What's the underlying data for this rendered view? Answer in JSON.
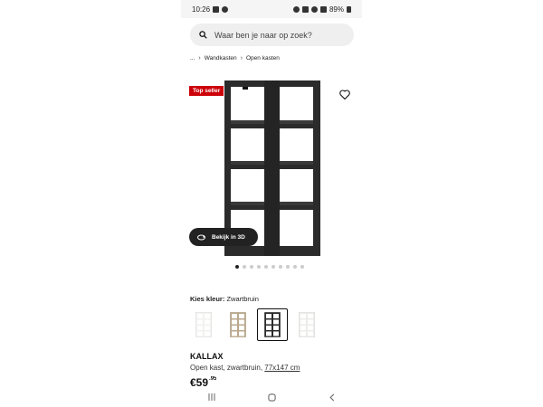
{
  "status_bar": {
    "time": "10:26",
    "battery": "89%"
  },
  "search": {
    "placeholder": "Waar ben je naar op zoek?"
  },
  "breadcrumb": {
    "items": [
      "...",
      "Wandkasten",
      "Open kasten"
    ]
  },
  "product": {
    "badge": "Top seller",
    "view_3d_label": "Bekijk in 3D",
    "image_count": 10,
    "active_image": 1,
    "color_label": "Kies kleur:",
    "color_value": "Zwartbruin",
    "name": "KALLAX",
    "description": "Open kast, zwartbruin,",
    "dimensions": "77x147 cm",
    "price_main": "€59",
    "price_decimals": ".95"
  },
  "swatches": [
    {
      "name": "wit",
      "color": "#f2f2f0"
    },
    {
      "name": "eiken",
      "color": "#b9a88c"
    },
    {
      "name": "zwartbruin",
      "color": "#2a2a2a",
      "selected": true
    },
    {
      "name": "wit-licht",
      "color": "#ececea"
    }
  ],
  "colors": {
    "badge": "#cc0008",
    "shelf": "#2b2b2b",
    "button_3d": "#222222"
  }
}
